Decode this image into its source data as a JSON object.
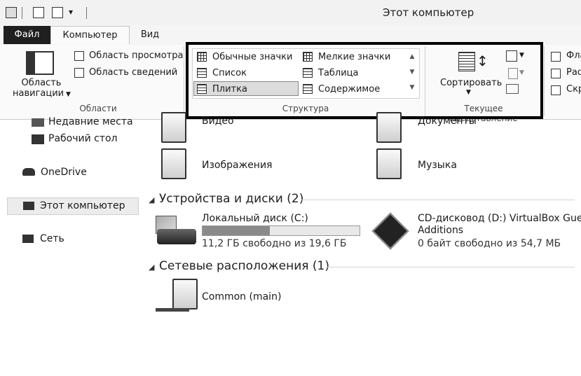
{
  "window": {
    "title": "Этот компьютер"
  },
  "tabs": {
    "file": "Файл",
    "computer": "Компьютер",
    "view": "Вид"
  },
  "ribbon": {
    "panes": {
      "nav_pane_line1": "Область",
      "nav_pane_line2": "навигации",
      "preview_pane": "Область просмотра",
      "details_pane": "Область сведений",
      "group_label": "Области"
    },
    "layout": {
      "items": [
        "Обычные значки",
        "Мелкие значки",
        "Список",
        "Таблица",
        "Плитка",
        "Содержимое"
      ],
      "selected": "Плитка",
      "group_label": "Структура"
    },
    "current_view": {
      "sort_label": "Сортировать",
      "group_label": "Текущее представление"
    },
    "show_hide": {
      "checkbox1": "Фла",
      "checkbox2": "Рас",
      "checkbox3": "Скр"
    }
  },
  "nav": {
    "recent": "Недавние места",
    "desktop": "Рабочий стол",
    "onedrive": "OneDrive",
    "this_pc": "Этот компьютер",
    "network": "Сеть"
  },
  "content": {
    "folders": {
      "video": "Видео",
      "documents": "Документы",
      "images": "Изображения",
      "music": "Музыка"
    },
    "devices": {
      "header": "Устройства и диски (2)",
      "local_disk": {
        "name": "Локальный диск (C:)",
        "free_text": "11,2 ГБ свободно из 19,6 ГБ",
        "used_fraction": 0.43
      },
      "cd_drive": {
        "name_line1": "CD-дисковод (D:) VirtualBox Guest",
        "name_line2": "Additions",
        "free_text": "0 байт свободно из 54,7 МБ"
      }
    },
    "network": {
      "header": "Сетевые расположения (1)",
      "share": "Common (main)"
    }
  }
}
